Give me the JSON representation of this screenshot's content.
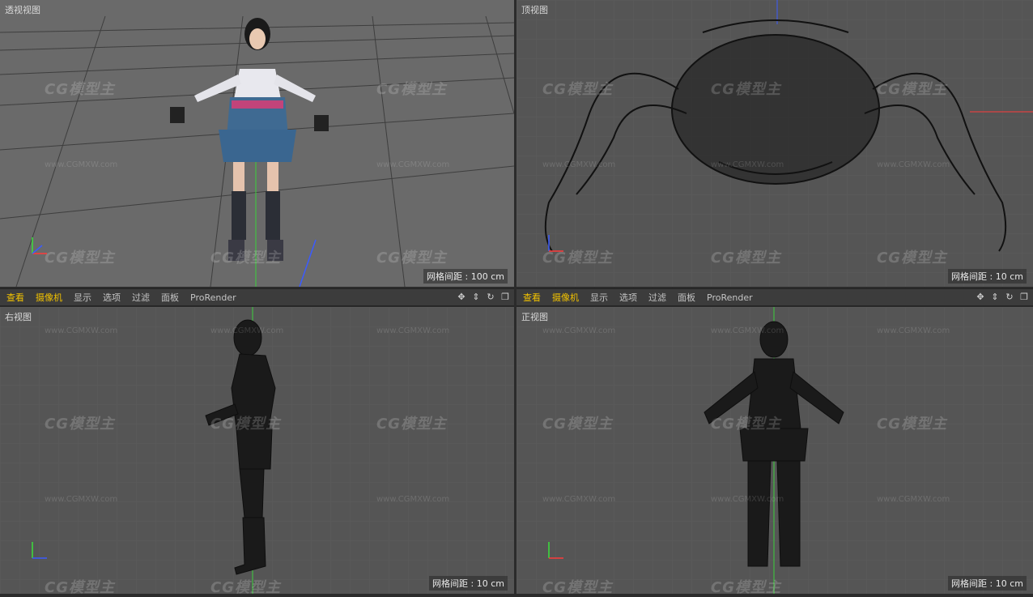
{
  "viewports": {
    "perspective": {
      "title": "透视视图",
      "grid_spacing": "网格间距 : 100 cm"
    },
    "top": {
      "title": "顶视图",
      "grid_spacing": "网格间距 : 10 cm"
    },
    "right": {
      "title": "右视图",
      "grid_spacing": "网格间距 : 10 cm"
    },
    "front": {
      "title": "正视图",
      "grid_spacing": "网格间距 : 10 cm"
    }
  },
  "toolbar": {
    "view": "查看",
    "camera": "摄像机",
    "display": "显示",
    "options": "选项",
    "filter": "过滤",
    "panel": "面板",
    "prorender": "ProRender"
  },
  "icons": {
    "move": "move-icon",
    "scroll": "scroll-arrows-icon",
    "rotate": "rotate-icon",
    "maximize": "maximize-icon"
  },
  "watermark": {
    "logo": "CG模型主",
    "url": "www.CGMXW.com"
  },
  "axes": {
    "x": "X",
    "y": "Y",
    "z": "Z"
  },
  "colors": {
    "viewport_bg": "#555555",
    "toolbar_bg": "#3c3c3c",
    "active_menu": "#f2c200",
    "axis_x": "#ff3b3b",
    "axis_y": "#3be03b",
    "axis_z": "#3b5bff"
  }
}
